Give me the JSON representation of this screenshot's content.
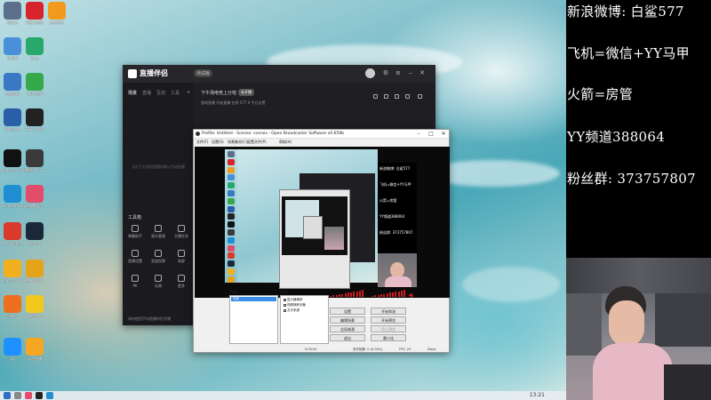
{
  "desktop": {
    "icons": [
      {
        "label": "回收站",
        "color": "#5b6e8a",
        "icon": "recycle-bin"
      },
      {
        "label": "网易云音乐",
        "color": "#d8232a",
        "icon": "netease-music"
      },
      {
        "label": "绝地求生",
        "color": "#f39a1e",
        "icon": "pubg"
      },
      {
        "label": "此电脑",
        "color": "#4a90d9",
        "icon": "this-pc"
      },
      {
        "label": "Edge",
        "color": "#28a86b",
        "icon": "edge"
      },
      {
        "label": "控制面板",
        "color": "#3b78c4",
        "icon": "control-panel"
      },
      {
        "label": "360浏览器",
        "color": "#35a84a",
        "icon": "browser"
      },
      {
        "label": "WeGame",
        "color": "#2b5ea8",
        "icon": "wegame"
      },
      {
        "label": "OBS Studio",
        "color": "#222222",
        "icon": "obs"
      },
      {
        "label": "Logitech G HUB",
        "color": "#111111",
        "icon": "logitech"
      },
      {
        "label": "PUBG LITE",
        "color": "#3a3a3a",
        "icon": "pubg-lite"
      },
      {
        "label": "Microsoft Edge",
        "color": "#1f8ed3",
        "icon": "ms-edge"
      },
      {
        "label": "直播伴侣",
        "color": "#e24b6a",
        "icon": "live-companion"
      },
      {
        "label": "WPS Office",
        "color": "#d93a2b",
        "icon": "wps"
      },
      {
        "label": "Steam",
        "color": "#1b2838",
        "icon": "steam"
      },
      {
        "label": "Tencent QQ",
        "color": "#f2b01e",
        "icon": "qq"
      },
      {
        "label": "夜神模拟器",
        "color": "#e5a31a",
        "icon": "emulator"
      },
      {
        "label": "火柴人",
        "color": "#ee6f20",
        "icon": "game"
      },
      {
        "label": "QQ游戏",
        "color": "#f3c81c",
        "icon": "qq-game"
      },
      {
        "label": "QQ",
        "color": "#1e90ff",
        "icon": "qq-penguin"
      },
      {
        "label": "斗鱼直播",
        "color": "#f5a623",
        "icon": "douyu"
      }
    ],
    "taskbar_time": "13:21"
  },
  "live_app": {
    "title": "直播伴侣",
    "version": "测试版",
    "tabs": [
      "场景",
      "直播",
      "互动",
      "工具"
    ],
    "empty_text": "点击下方添加直播场景以开始直播",
    "tools_header": "工具箱",
    "tools": [
      "弹幕助手",
      "观众管理",
      "主播任务",
      "直播设置",
      "发起投票",
      "录屏",
      "PK",
      "礼物",
      "更多"
    ],
    "footer": "如何使用手机直播伴侣开播",
    "room_title": "下午场电竞上分啦",
    "room_badge": "未开播",
    "room_meta": "游戏直播  开始直播    在线 577    0     今日点赞",
    "notice": "C站流量扶持计划正在进行中，开播即可获得",
    "go_live": "开播"
  },
  "obs": {
    "title": "Profile: Untitled - Scenes: scenes - Open Broadcaster Software v0.659b",
    "menu": [
      "文件(F)",
      "设置(S)",
      "场景集合(C)",
      "配置文件(P)",
      "帮助(H)"
    ],
    "scenes_header": "场景:",
    "scenes": [
      "场景"
    ],
    "sources_header": "来源:",
    "sources": [
      "显示器捕获",
      "视频捕获设备",
      "文字来源"
    ],
    "buttons": [
      "设置",
      "开始串流",
      "编辑场景",
      "开始预览",
      "全局来源",
      "停止预览",
      "退出",
      "最小化"
    ],
    "status": {
      "time": "0:00:00",
      "dropped": "丢失帧数: 0 (0.00%)",
      "fps": "FPS: 29",
      "bitrate": "0kb/s"
    }
  },
  "overlay": {
    "lines": [
      "新浪微博: 白鲨577",
      "飞机=微信+YY马甲",
      "火箭=房管",
      "YY频道388064",
      "粉丝群: 373757807"
    ]
  },
  "colors": {
    "panel_bg": "#000000",
    "overlay_text": "#ffffff",
    "obs_selection": "#3a8ee6",
    "meter_red": "#c81e1e",
    "app_dark": "#1f1f23"
  }
}
